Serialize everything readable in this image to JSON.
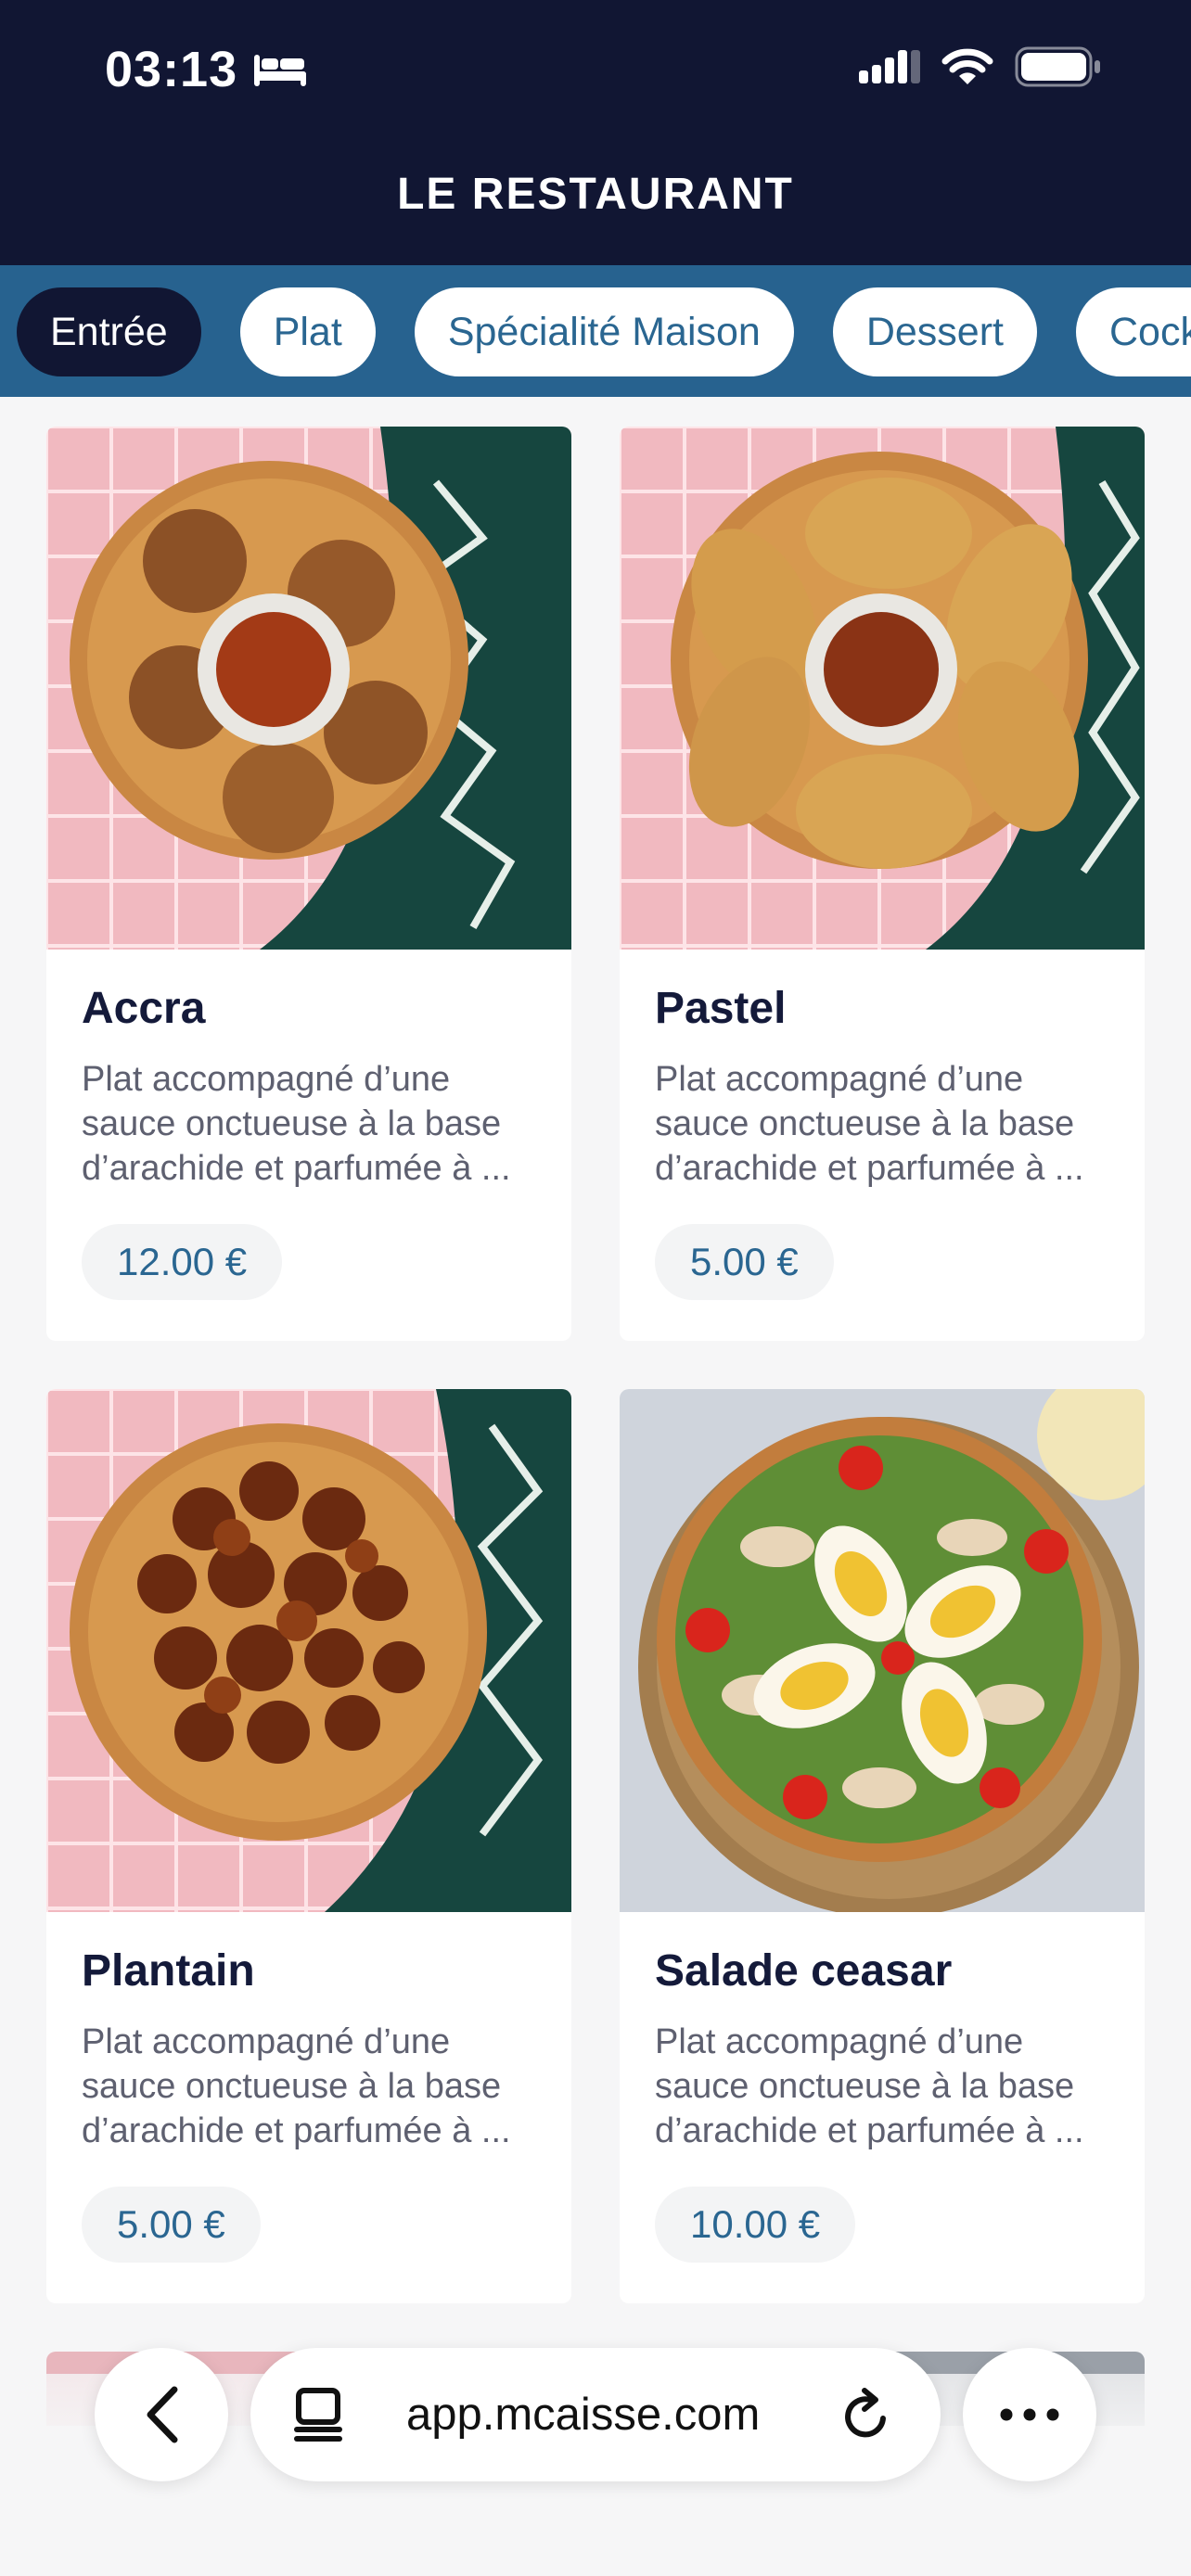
{
  "status_bar": {
    "time": "03:13"
  },
  "header": {
    "title": "LE RESTAURANT"
  },
  "categories": [
    {
      "label": "Entrée",
      "active": true
    },
    {
      "label": "Plat",
      "active": false
    },
    {
      "label": "Spécialité Maison",
      "active": false
    },
    {
      "label": "Dessert",
      "active": false
    },
    {
      "label": "Cocktail",
      "active": false
    }
  ],
  "items": [
    {
      "name": "Accra",
      "description": "Plat accompagné d’une sauce onctueuse à la base d’arachide et parfumée à ...",
      "price": "12.00 €"
    },
    {
      "name": "Pastel",
      "description": "Plat accompagné d’une sauce onctueuse à la base d’arachide et parfumée à ...",
      "price": "5.00 €"
    },
    {
      "name": "Plantain",
      "description": "Plat accompagné d’une sauce onctueuse à la base d’arachide et parfumée à ...",
      "price": "5.00 €"
    },
    {
      "name": "Salade ceasar",
      "description": "Plat accompagné d’une sauce onctueuse à la base d’arachide et parfumée à ...",
      "price": "10.00 €"
    }
  ],
  "browser": {
    "url": "app.mcaisse.com"
  },
  "colors": {
    "header": "#111633",
    "category_bar": "#27628f",
    "accent": "#2a6691"
  }
}
